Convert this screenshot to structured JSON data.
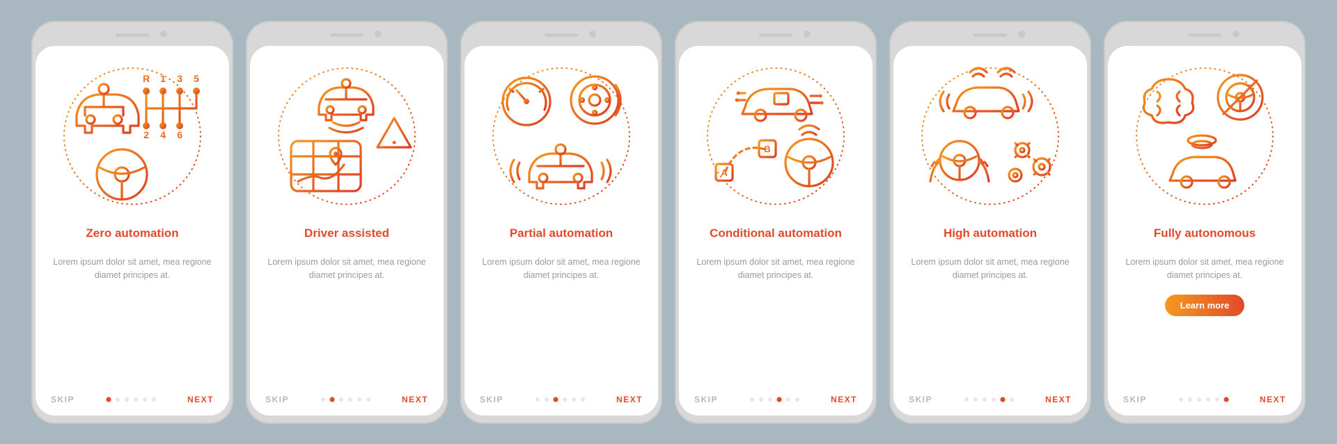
{
  "common": {
    "skip_label": "SKIP",
    "next_label": "NEXT",
    "cta_label": "Learn more",
    "description": "Lorem ipsum dolor sit amet, mea regione diamet principes at.",
    "dot_count": 6
  },
  "gears": [
    "R",
    "1",
    "3",
    "5",
    "2",
    "4",
    "6"
  ],
  "waypoints": [
    "A",
    "B"
  ],
  "screens": [
    {
      "title": "Zero automation",
      "active_dot": 0,
      "show_cta": false
    },
    {
      "title": "Driver assisted",
      "active_dot": 1,
      "show_cta": false
    },
    {
      "title": "Partial automation",
      "active_dot": 2,
      "show_cta": false
    },
    {
      "title": "Conditional automation",
      "active_dot": 3,
      "show_cta": false
    },
    {
      "title": "High automation",
      "active_dot": 4,
      "show_cta": false
    },
    {
      "title": "Fully autonomous",
      "active_dot": 5,
      "show_cta": true
    }
  ]
}
